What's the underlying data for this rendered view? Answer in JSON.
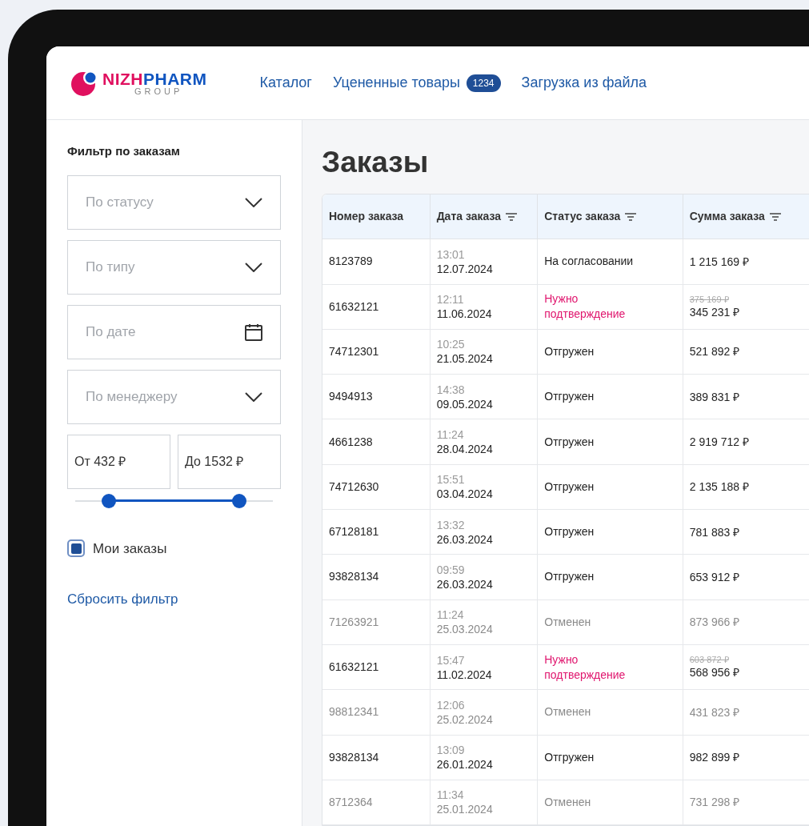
{
  "header": {
    "logo": {
      "first": "NIZH",
      "second": "PHARM",
      "sub": "GROUP"
    },
    "nav": [
      {
        "label": "Каталог"
      },
      {
        "label": "Уцененные товары",
        "badge": "1234"
      },
      {
        "label": "Загрузка из файла"
      }
    ]
  },
  "sidebar": {
    "title": "Фильтр по заказам",
    "fields": [
      {
        "kind": "select",
        "placeholder": "По статусу"
      },
      {
        "kind": "select",
        "placeholder": "По типу"
      },
      {
        "kind": "date",
        "placeholder": "По дате"
      },
      {
        "kind": "select",
        "placeholder": "По менеджеру"
      }
    ],
    "price_from": "От 432 ₽",
    "price_to": "До 1532 ₽",
    "range_thumbs": [
      {
        "level": 0.17
      },
      {
        "level": 0.83
      }
    ],
    "my_orders": {
      "label": "Мои заказы",
      "checked": true
    },
    "reset": "Сбросить фильтр"
  },
  "page_title": "Заказы",
  "table": {
    "columns": [
      {
        "label": "Номер заказа",
        "filterable": false
      },
      {
        "label": "Дата заказа",
        "filterable": true
      },
      {
        "label": "Статус заказа",
        "filterable": true
      },
      {
        "label": "Сумма заказа",
        "filterable": true
      }
    ],
    "rows": [
      {
        "kind": "active",
        "number": "8123789",
        "time": "13:01",
        "date": "12.07.2024",
        "status": "На согласовании",
        "sum": "1 215 169 ₽"
      },
      {
        "kind": "attention",
        "number": "61632121",
        "time": "12:11",
        "date": "11.06.2024",
        "status": "Нужно подтверждение",
        "old_sum": "375 169 ₽",
        "sum": "345 231 ₽"
      },
      {
        "kind": "active",
        "number": "74712301",
        "time": "10:25",
        "date": "21.05.2024",
        "status": "Отгружен",
        "sum": "521 892 ₽"
      },
      {
        "kind": "active",
        "number": "9494913",
        "time": "14:38",
        "date": "09.05.2024",
        "status": "Отгружен",
        "sum": "389 831 ₽"
      },
      {
        "kind": "active",
        "number": "4661238",
        "time": "11:24",
        "date": "28.04.2024",
        "status": "Отгружен",
        "sum": "2 919 712 ₽"
      },
      {
        "kind": "active",
        "number": "74712630",
        "time": "15:51",
        "date": "03.04.2024",
        "status": "Отгружен",
        "sum": "2 135 188 ₽"
      },
      {
        "kind": "active",
        "number": "67128181",
        "time": "13:32",
        "date": "26.03.2024",
        "status": "Отгружен",
        "sum": "781 883 ₽"
      },
      {
        "kind": "active",
        "number": "93828134",
        "time": "09:59",
        "date": "26.03.2024",
        "status": "Отгружен",
        "sum": "653 912 ₽"
      },
      {
        "kind": "cancelled",
        "number": "71263921",
        "time": "11:24",
        "date": "25.03.2024",
        "status": "Отменен",
        "sum": "873 966 ₽"
      },
      {
        "kind": "attention",
        "number": "61632121",
        "time": "15:47",
        "date": "11.02.2024",
        "status": "Нужно подтверждение",
        "old_sum": "603 872 ₽",
        "sum": "568 956 ₽"
      },
      {
        "kind": "cancelled",
        "number": "98812341",
        "time": "12:06",
        "date": "25.02.2024",
        "status": "Отменен",
        "sum": "431 823 ₽"
      },
      {
        "kind": "active",
        "number": "93828134",
        "time": "13:09",
        "date": "26.01.2024",
        "status": "Отгружен",
        "sum": "982 899 ₽"
      },
      {
        "kind": "cancelled",
        "number": "8712364",
        "time": "11:34",
        "date": "25.01.2024",
        "status": "Отменен",
        "sum": "731 298 ₽"
      }
    ]
  }
}
